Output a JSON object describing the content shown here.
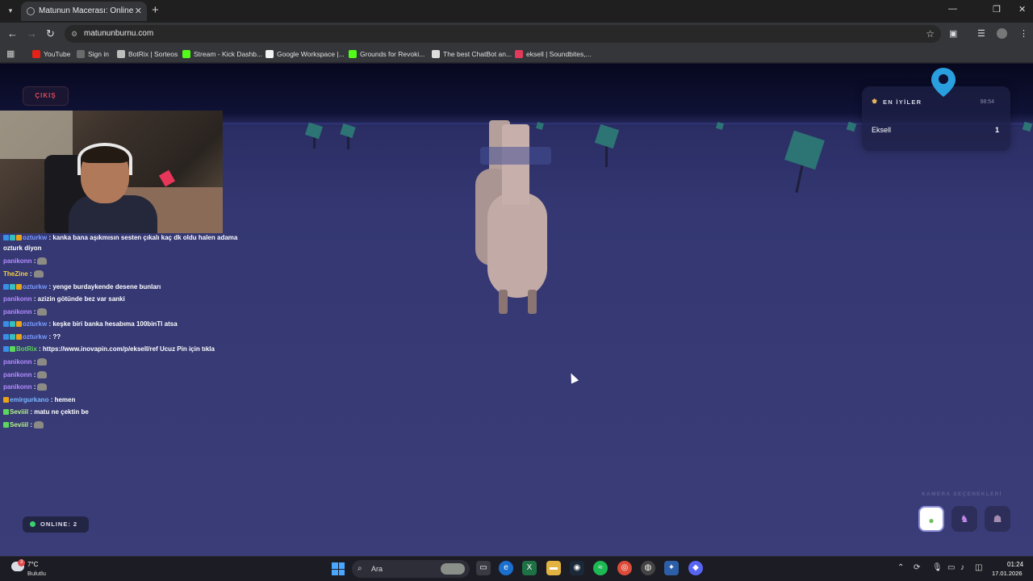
{
  "browser": {
    "tab_title": "Matunun Macerası: Online",
    "url": "matununburnu.com",
    "bookmarks": [
      {
        "label": "YouTube",
        "color": "#e62117"
      },
      {
        "label": "Sign in",
        "color": "#6b6b6b"
      },
      {
        "label": "BotRix | Sorteos",
        "color": "#bdbdbd"
      },
      {
        "label": "Stream - Kick Dashb...",
        "color": "#53fc18"
      },
      {
        "label": "Google Workspace |...",
        "color": "#f2f2f2"
      },
      {
        "label": "Grounds for Revoki...",
        "color": "#53fc18"
      },
      {
        "label": "The best ChatBot an...",
        "color": "#dddddd"
      },
      {
        "label": "eksell | Soundbites,...",
        "color": "#e23a5a"
      }
    ]
  },
  "game": {
    "exit_label": "ÇIKIŞ",
    "player_tag": "",
    "leaderboard": {
      "title": "EN İYİLER",
      "timer": "98:54",
      "rows": [
        {
          "name": "Eksell",
          "score": "1"
        }
      ]
    },
    "online_label": "ONLINE: 2",
    "camera_label": "KAMERA SEÇENEKLERİ",
    "camera_icons": [
      "person-icon",
      "unicorn-icon",
      "cat-icon"
    ]
  },
  "chat": [
    {
      "user": "ozturkw",
      "color": "#7a9cff",
      "text": " : kanka bana aşıkmısın sesten çıkalı kaç dk oldu halen adama",
      "badges": [
        "#3a8ee6",
        "#37c0c0",
        "#e8a317"
      ]
    },
    {
      "user": "",
      "color": "#ffffff",
      "text": "ozturk diyon",
      "badges": []
    },
    {
      "user": "panikonn",
      "color": "#b48cff",
      "text": " :",
      "badges": [],
      "emote": true
    },
    {
      "user": "TheZine",
      "color": "#f5d142",
      "text": " :",
      "badges": [],
      "emote": true
    },
    {
      "user": "ozturkw",
      "color": "#7a9cff",
      "text": " : yenge burdaykende desene bunları",
      "badges": [
        "#3a8ee6",
        "#37c0c0",
        "#e8a317"
      ]
    },
    {
      "user": "panikonn",
      "color": "#b48cff",
      "text": " : azizin götünde bez var sanki",
      "badges": []
    },
    {
      "user": "panikonn",
      "color": "#b48cff",
      "text": " :",
      "badges": [],
      "emote": true
    },
    {
      "user": "ozturkw",
      "color": "#7a9cff",
      "text": " : keşke biri banka hesabıma 100binTl atsa",
      "badges": [
        "#3a8ee6",
        "#37c0c0",
        "#e8a317"
      ]
    },
    {
      "user": "ozturkw",
      "color": "#7a9cff",
      "text": " : ??",
      "badges": [
        "#3a8ee6",
        "#37c0c0",
        "#e8a317"
      ]
    },
    {
      "user": "BotRix",
      "color": "#5cd65c",
      "text": " : https://www.inovapin.com/p/eksell/ref Ucuz Pin için tıkla",
      "badges": [
        "#3a8ee6",
        "#5cd65c"
      ]
    },
    {
      "user": "panikonn",
      "color": "#b48cff",
      "text": " :",
      "badges": [],
      "emote": true
    },
    {
      "user": "panikonn",
      "color": "#b48cff",
      "text": " :",
      "badges": [],
      "emote": true
    },
    {
      "user": "panikonn",
      "color": "#b48cff",
      "text": " :",
      "badges": [],
      "emote": true
    },
    {
      "user": "emirgurkano",
      "color": "#79b7ff",
      "text": " : hemen",
      "badges": [
        "#e8a317"
      ]
    },
    {
      "user": "Seviiil",
      "color": "#b8f58a",
      "text": " : matu ne çektin be",
      "badges": [
        "#5cd65c"
      ]
    },
    {
      "user": "Seviiil",
      "color": "#b8f58a",
      "text": " :",
      "badges": [
        "#5cd65c"
      ],
      "emote": true
    }
  ],
  "taskbar": {
    "temperature": "7°C",
    "weather": "Bulutlu",
    "weather_badge": "3",
    "search_label": "Ara",
    "time": "01:24",
    "date": "17.01.2026"
  }
}
